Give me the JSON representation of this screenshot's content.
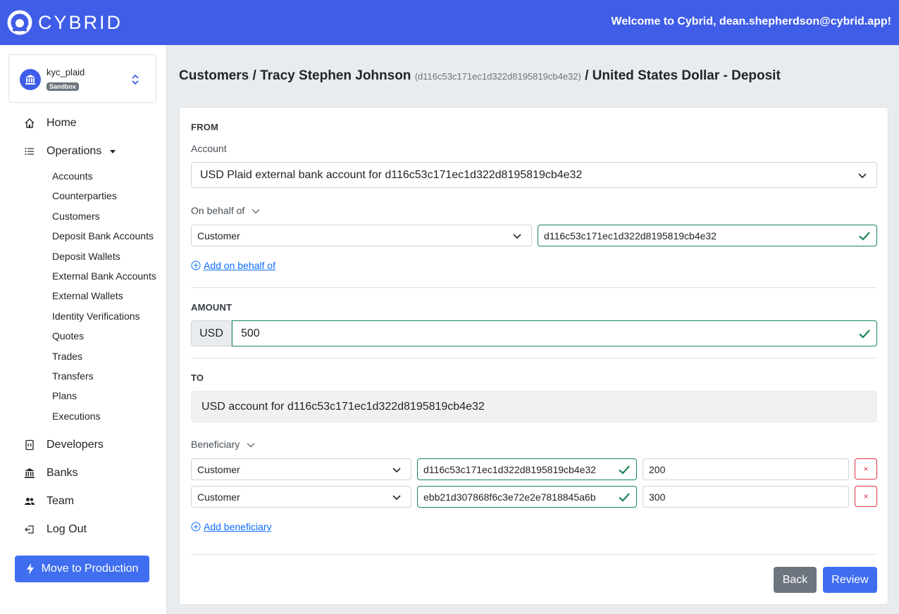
{
  "header": {
    "brand": "CYBRID",
    "welcome": "Welcome to Cybrid, dean.shepherdson@cybrid.app!"
  },
  "bank": {
    "name": "kyc_plaid",
    "environment": "Sandbox"
  },
  "nav": {
    "home": "Home",
    "operations": "Operations",
    "sub": [
      "Accounts",
      "Counterparties",
      "Customers",
      "Deposit Bank Accounts",
      "Deposit Wallets",
      "External Bank Accounts",
      "External Wallets",
      "Identity Verifications",
      "Quotes",
      "Trades",
      "Transfers",
      "Plans",
      "Executions"
    ],
    "developers": "Developers",
    "banks": "Banks",
    "team": "Team",
    "logout": "Log Out",
    "move_to_production": "Move to Production"
  },
  "title": {
    "part1": "Customers / Tracy Stephen Johnson",
    "customer_id": "(d116c53c171ec1d322d8195819cb4e32)",
    "part2": "/ United States Dollar - Deposit"
  },
  "from": {
    "section": "FROM",
    "account_label": "Account",
    "account_value": "USD Plaid external bank account for d116c53c171ec1d322d8195819cb4e32",
    "on_behalf_label": "On behalf of",
    "on_behalf_type": "Customer",
    "on_behalf_id": "d116c53c171ec1d322d8195819cb4e32",
    "add_on_behalf": "Add on behalf of"
  },
  "amount": {
    "section": "AMOUNT",
    "currency": "USD",
    "value": "500"
  },
  "to": {
    "section": "TO",
    "account": "USD account for d116c53c171ec1d322d8195819cb4e32",
    "beneficiary_label": "Beneficiary",
    "beneficiaries": [
      {
        "type": "Customer",
        "id": "d116c53c171ec1d322d8195819cb4e32",
        "amount": "200"
      },
      {
        "type": "Customer",
        "id": "ebb21d307868f6c3e72e2e7818845a6b",
        "amount": "300"
      }
    ],
    "remove_label": "×",
    "add_beneficiary": "Add beneficiary"
  },
  "actions": {
    "back": "Back",
    "review": "Review"
  },
  "colors": {
    "brand": "#3f5de6",
    "primary_button": "#3f6ef0",
    "success": "#198754",
    "danger": "#dc3545"
  }
}
